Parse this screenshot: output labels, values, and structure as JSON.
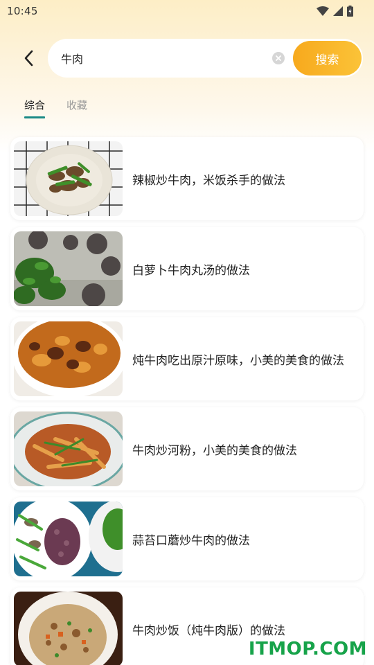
{
  "status_bar": {
    "time": "10:45"
  },
  "search": {
    "query": "牛肉",
    "button_label": "搜索"
  },
  "tabs": [
    {
      "label": "综合",
      "active": true
    },
    {
      "label": "收藏",
      "active": false
    }
  ],
  "results": [
    {
      "title": "辣椒炒牛肉，米饭杀手的做法"
    },
    {
      "title": "白萝卜牛肉丸汤的做法"
    },
    {
      "title": "炖牛肉吃出原汁原味，小美的美食的做法"
    },
    {
      "title": "牛肉炒河粉，小美的美食的做法"
    },
    {
      "title": "蒜苔口蘑炒牛肉的做法"
    },
    {
      "title": "牛肉炒饭（炖牛肉版）的做法"
    }
  ],
  "watermark": "ITMOP.COM",
  "colors": {
    "accent_orange": "#f7a91d",
    "tab_indicator": "#1a8a86",
    "watermark_green": "#17a34a"
  }
}
